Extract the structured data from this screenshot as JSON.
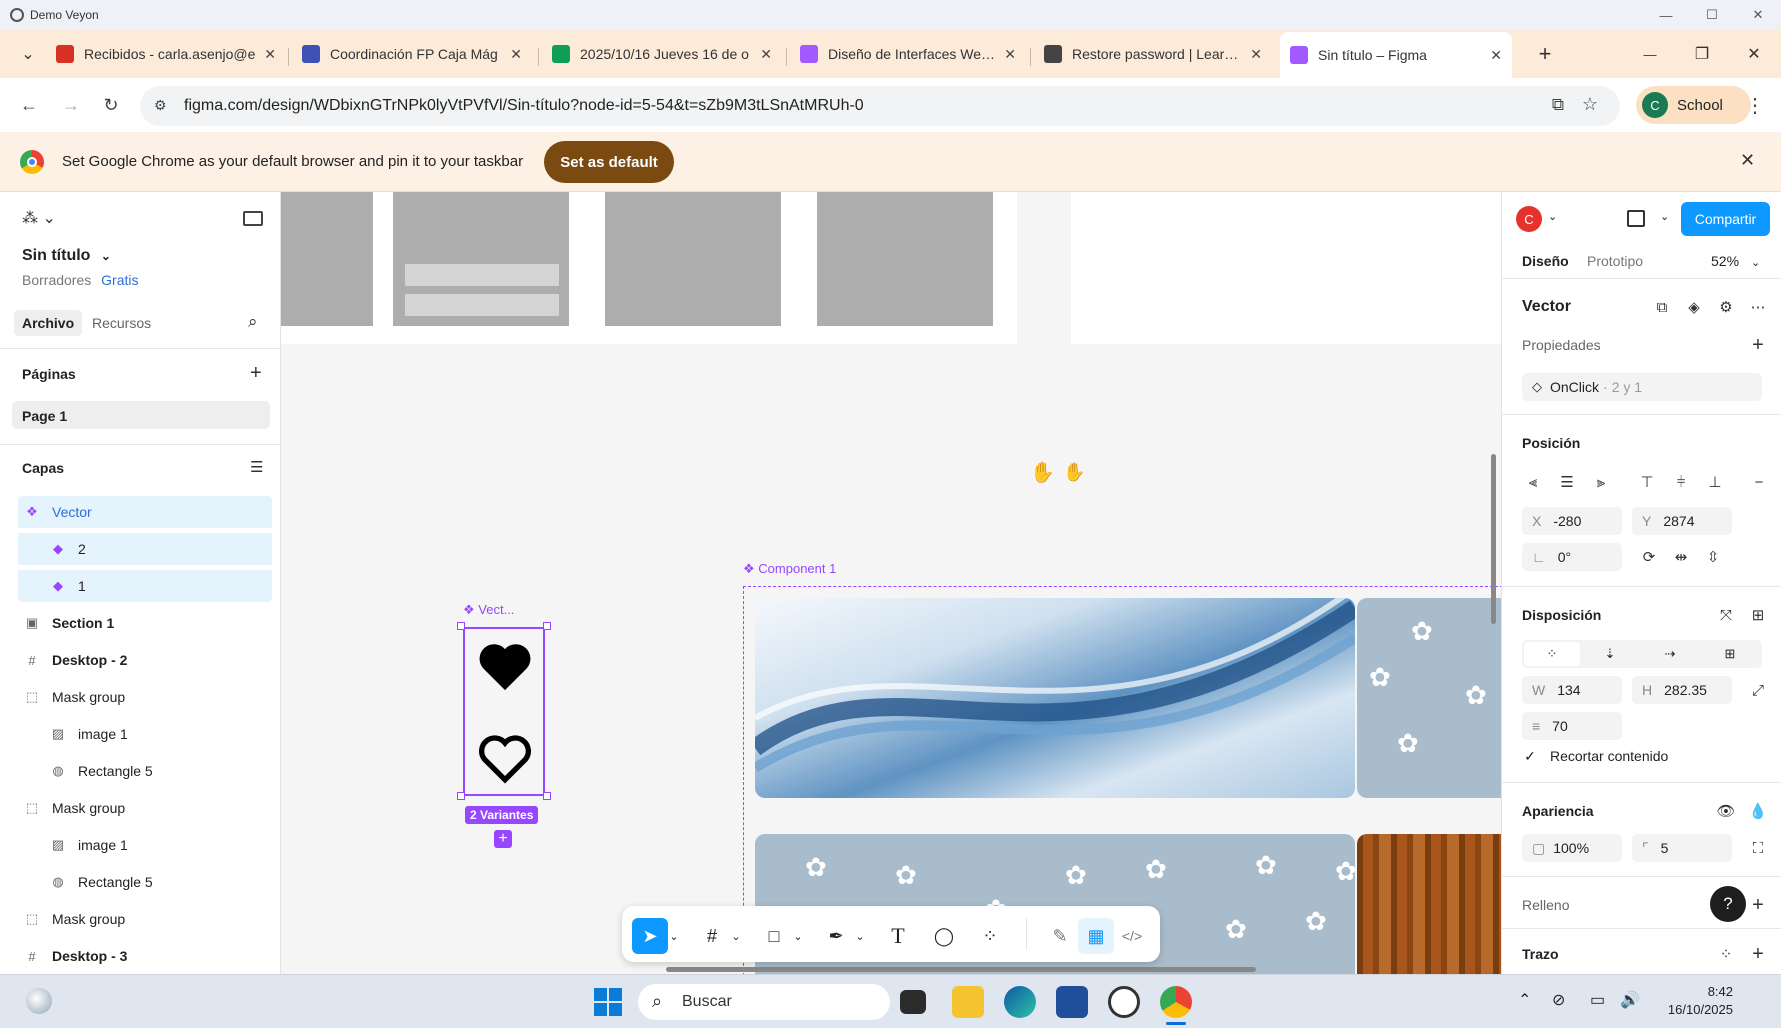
{
  "window": {
    "title": "Demo Veyon",
    "minimize": "—",
    "maximize": "☐",
    "close": "✕"
  },
  "tabs": [
    {
      "label": "Recibidos - carla.asenjo@e",
      "favicon": "gmail-icon",
      "color": "#d93025"
    },
    {
      "label": "Coordinación FP Caja Mág",
      "favicon": "forms-icon",
      "color": "#3f51b5"
    },
    {
      "label": "2025/10/16 Jueves 16 de o",
      "favicon": "sheets-icon",
      "color": "#0f9d58"
    },
    {
      "label": "Diseño de Interfaces Web -",
      "favicon": "figma-icon",
      "color": "#a259ff"
    },
    {
      "label": "Restore password | Learnin",
      "favicon": "page-icon",
      "color": "#444444"
    },
    {
      "label": "Sin título – Figma",
      "favicon": "figma-icon",
      "color": "#a259ff"
    }
  ],
  "tabstrip": {
    "dropdown": "⌄",
    "new_tab": "+",
    "minimize": "—",
    "maximize": "❐",
    "close": "✕"
  },
  "address": {
    "url": "figma.com/design/WDbixnGTrNPk0lyVtPVfVl/Sin-título?node-id=5-54&t=sZb9M3tLSnAtMRUh-0",
    "profile_initial": "C",
    "profile_label": "School"
  },
  "infobar": {
    "message": "Set Google Chrome as your default browser and pin it to your taskbar",
    "button": "Set as default",
    "close": "✕"
  },
  "left_panel": {
    "file_name": "Sin título",
    "drafts": "Borradores",
    "plan": "Gratis",
    "tabs": [
      "Archivo",
      "Recursos"
    ],
    "pages_heading": "Páginas",
    "pages": [
      "Page 1"
    ],
    "layers_heading": "Capas",
    "layers": [
      {
        "name": "Vector",
        "icon": "component-set-icon",
        "indent": 0
      },
      {
        "name": "2",
        "icon": "variant-icon",
        "indent": 1
      },
      {
        "name": "1",
        "icon": "variant-icon",
        "indent": 1
      },
      {
        "name": "Section 1",
        "icon": "section-icon",
        "indent": 0
      },
      {
        "name": "Desktop - 2",
        "icon": "frame-icon",
        "indent": 0
      },
      {
        "name": "Mask group",
        "icon": "mask-icon",
        "indent": 0
      },
      {
        "name": "image 1",
        "icon": "image-icon",
        "indent": 1
      },
      {
        "name": "Rectangle 5",
        "icon": "mask-shape-icon",
        "indent": 1
      },
      {
        "name": "Mask group",
        "icon": "mask-icon",
        "indent": 0
      },
      {
        "name": "image 1",
        "icon": "image-icon",
        "indent": 1
      },
      {
        "name": "Rectangle 5",
        "icon": "mask-shape-icon",
        "indent": 1
      },
      {
        "name": "Mask group",
        "icon": "mask-icon",
        "indent": 0
      },
      {
        "name": "Desktop - 3",
        "icon": "frame-icon",
        "indent": 0
      }
    ]
  },
  "canvas": {
    "component_label": "Component 1",
    "vector_label": "Vect...",
    "variants_badge": "2 Variantes"
  },
  "right_panel": {
    "avatar": "C",
    "share": "Compartir",
    "tabs": [
      "Diseño",
      "Prototipo"
    ],
    "zoom": "52%",
    "layer_title": "Vector",
    "properties_heading": "Propiedades",
    "property": {
      "name": "OnClick",
      "value": "2 y 1"
    },
    "position_heading": "Posición",
    "x_label": "X",
    "x": "-280",
    "y_label": "Y",
    "y": "2874",
    "rotation": "0°",
    "layout_heading": "Disposición",
    "w_label": "W",
    "w": "134",
    "h_label": "H",
    "h": "282.35",
    "gap": "70",
    "clip_content": "Recortar contenido",
    "appearance_heading": "Apariencia",
    "opacity": "100%",
    "radius": "5",
    "fill_heading": "Relleno",
    "stroke_heading": "Trazo",
    "help": "?"
  },
  "taskbar": {
    "search_placeholder": "Buscar",
    "time": "8:42",
    "date": "16/10/2025"
  }
}
